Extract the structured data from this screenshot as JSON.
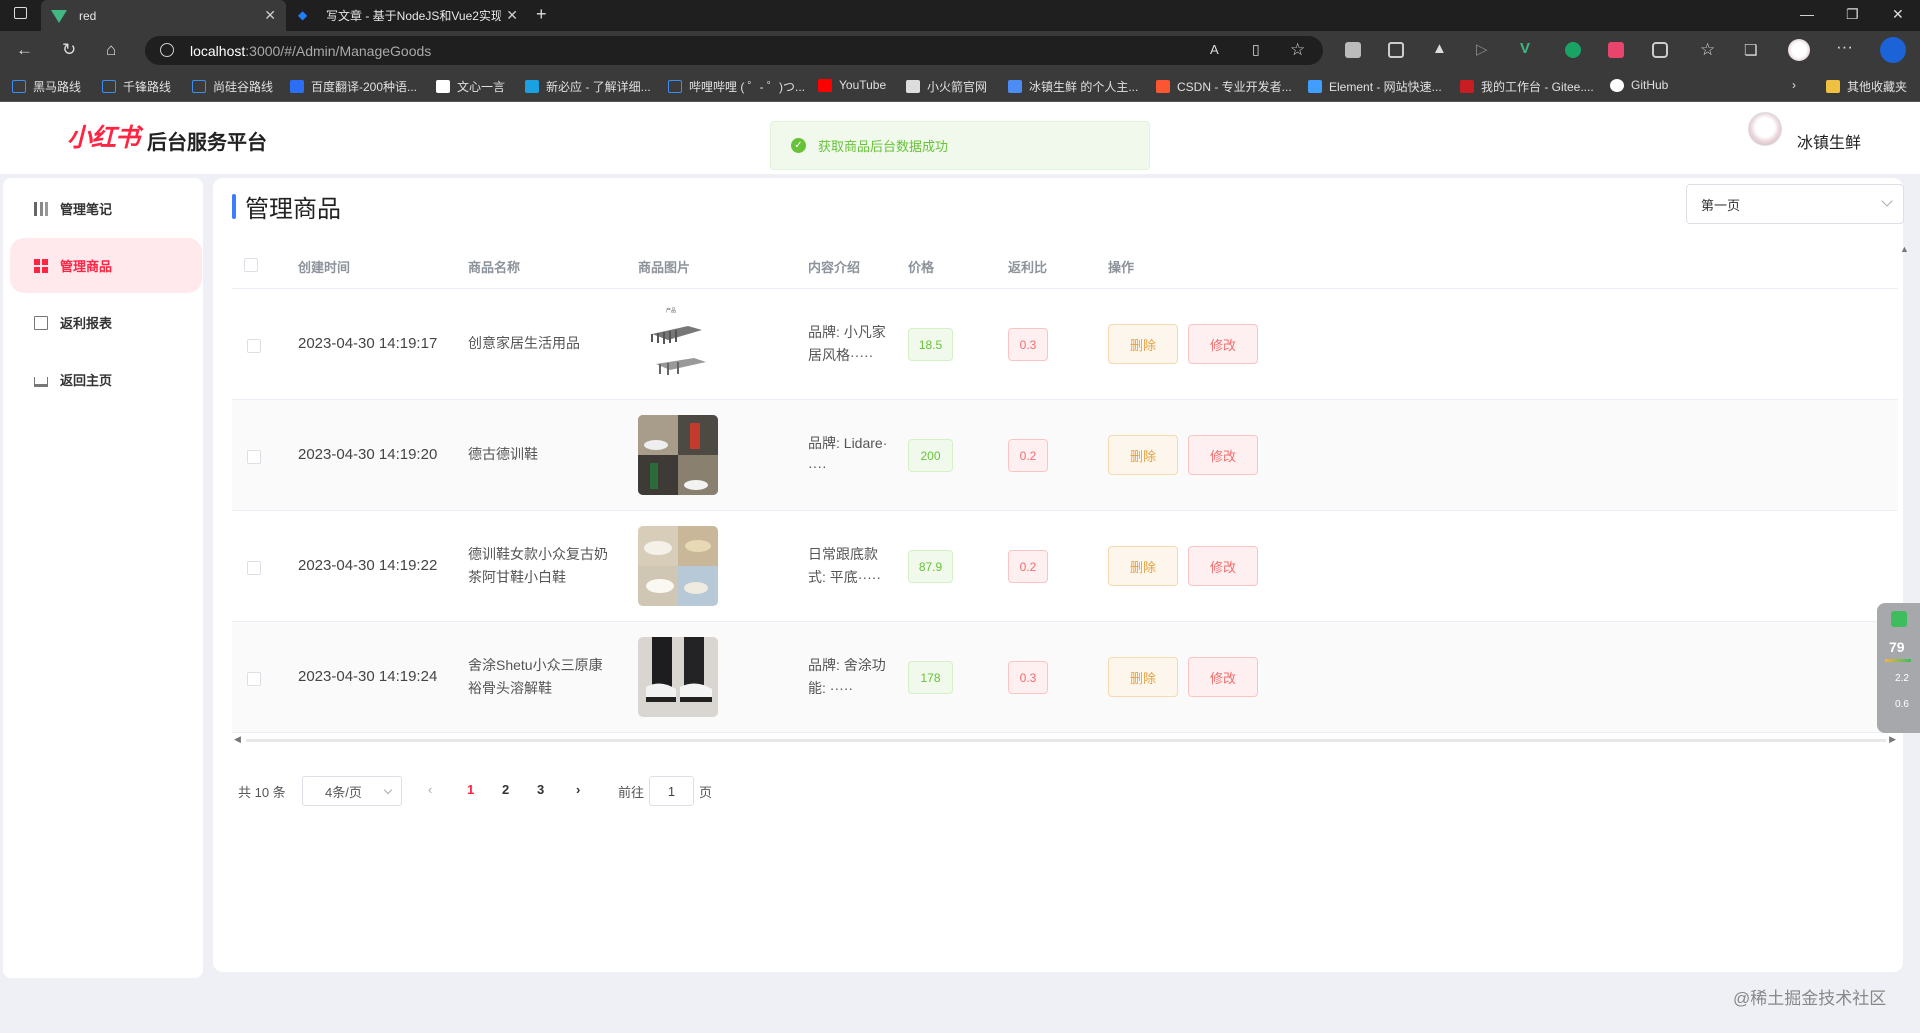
{
  "browser": {
    "tabs": [
      {
        "title": "red"
      },
      {
        "title": "写文章 - 基于NodeJS和Vue2实现"
      }
    ],
    "url_host": "localhost",
    "url_path": ":3000/#/Admin/ManageGoods",
    "bookmarks": [
      {
        "label": "黑马路线",
        "color": "#3d8ef0"
      },
      {
        "label": "千锋路线",
        "color": "#3d8ef0"
      },
      {
        "label": "尚硅谷路线",
        "color": "#3d8ef0"
      },
      {
        "label": "百度翻译-200种语...",
        "color": "#2d6ef7"
      },
      {
        "label": "文心一言",
        "color": "#ffffff"
      },
      {
        "label": "新必应 - 了解详细...",
        "color": "#1ba1e2"
      },
      {
        "label": "哔哩哔哩 ( ゜- ゜)つ...",
        "color": "#3d8ef0"
      },
      {
        "label": "YouTube",
        "color": "#ff0000"
      },
      {
        "label": "小火箭官网",
        "color": "#dddddd"
      },
      {
        "label": "冰镇生鲜 的个人主...",
        "color": "#4c8cf5"
      },
      {
        "label": "CSDN - 专业开发者...",
        "color": "#fc5531"
      },
      {
        "label": "Element - 网站快速...",
        "color": "#409eff"
      },
      {
        "label": "我的工作台 - Gitee....",
        "color": "#c71d23"
      },
      {
        "label": "GitHub",
        "color": "#ffffff"
      }
    ],
    "bookmarks_other": "其他收藏夹"
  },
  "header": {
    "logo": "小红书",
    "title": "后台服务平台",
    "toast": "获取商品后台数据成功",
    "user": "冰镇生鲜"
  },
  "sidebar": {
    "items": [
      {
        "label": "管理笔记",
        "icon": "notes-icon",
        "active": false
      },
      {
        "label": "管理商品",
        "icon": "grid-icon",
        "active": true
      },
      {
        "label": "返利报表",
        "icon": "report-icon",
        "active": false
      },
      {
        "label": "返回主页",
        "icon": "home-icon",
        "active": false
      }
    ]
  },
  "main": {
    "title": "管理商品",
    "page_select": "第一页",
    "columns": [
      "创建时间",
      "商品名称",
      "商品图片",
      "内容介绍",
      "价格",
      "返利比",
      "操作"
    ],
    "rows": [
      {
        "time": "2023-04-30 14:19:17",
        "name1": "创意家居生活用品",
        "name2": "",
        "intro1": "品牌: 小凡家",
        "intro2": "居风格·····",
        "price": "18.5",
        "rebate": "0.3"
      },
      {
        "time": "2023-04-30 14:19:20",
        "name1": "德古德训鞋",
        "name2": "",
        "intro1": "品牌: Lidare·",
        "intro2": "····",
        "price": "200",
        "rebate": "0.2"
      },
      {
        "time": "2023-04-30 14:19:22",
        "name1": "德训鞋女款小众复古奶",
        "name2": "茶阿甘鞋小白鞋",
        "intro1": "日常跟底款",
        "intro2": "式: 平底·····",
        "price": "87.9",
        "rebate": "0.2"
      },
      {
        "time": "2023-04-30 14:19:24",
        "name1": "舍涂Shetu小众三原康",
        "name2": "裕骨头溶解鞋",
        "intro1": "品牌: 舍涂功",
        "intro2": "能: ·····",
        "price": "178",
        "rebate": "0.3"
      }
    ],
    "delete_label": "删除",
    "edit_label": "修改"
  },
  "pagination": {
    "total": "共 10 条",
    "page_size": "4条/页",
    "pages": [
      "1",
      "2",
      "3"
    ],
    "current": "1",
    "goto_prefix": "前往",
    "goto_value": "1",
    "goto_suffix": "页"
  },
  "watermark": "@稀土掘金技术社区",
  "widget": {
    "percent": "79",
    "up": "2.2",
    "down": "0.6"
  }
}
